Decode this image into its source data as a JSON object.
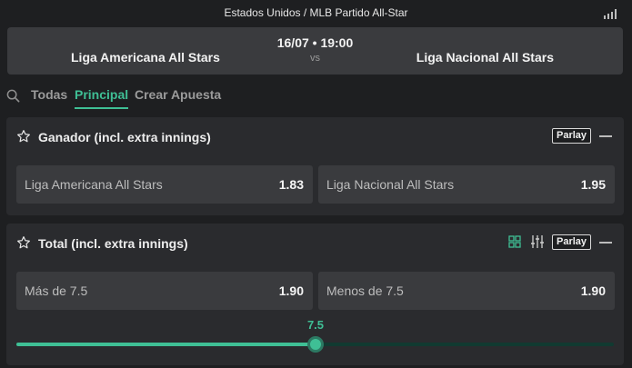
{
  "top": {
    "breadcrumb": "Estados Unidos / MLB Partido All-Star",
    "icon": "signal-bars-icon"
  },
  "event": {
    "home_team": "Liga Americana All Stars",
    "away_team": "Liga Nacional All Stars",
    "datetime": "16/07 • 19:00",
    "vs": "vs"
  },
  "tabs": {
    "todas": "Todas",
    "principal": "Principal",
    "crear": "Crear Apuesta"
  },
  "markets": {
    "winner": {
      "title": "Ganador (incl. extra innings)",
      "parlay": "Parlay",
      "options": [
        {
          "label": "Liga Americana All Stars",
          "price": "1.83"
        },
        {
          "label": "Liga Nacional All Stars",
          "price": "1.95"
        }
      ]
    },
    "total": {
      "title": "Total (incl. extra innings)",
      "parlay": "Parlay",
      "options": [
        {
          "label": "Más de 7.5",
          "price": "1.90"
        },
        {
          "label": "Menos de 7.5",
          "price": "1.90"
        }
      ],
      "slider": {
        "value": "7.5",
        "level": 0.5
      }
    }
  },
  "colors": {
    "accent": "#3fbf95",
    "background": "#1e1f21",
    "panel": "#2a2b2e",
    "button": "#3a3b3e"
  }
}
